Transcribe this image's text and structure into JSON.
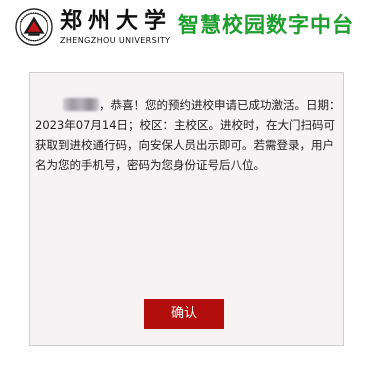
{
  "header": {
    "logo_icon": "zzu-emblem-icon",
    "university_name": "郑州大学",
    "university_name_en": "ZHENGZHOU UNIVERSITY",
    "platform_name": "智慧校园数字中台",
    "platform_color": "#1c9f2c"
  },
  "message": {
    "greeting": "，恭喜！您的预约进校申请已成功激活。日期：2023年07月14日；校区：主校区。进校时，在大门扫码可获取到进校通行码，向安保人员出示即可。若需登录，用户名为您的手机号，密码为您身份证号后八位。"
  },
  "actions": {
    "confirm_label": "确认",
    "confirm_color": "#b30e0e"
  }
}
